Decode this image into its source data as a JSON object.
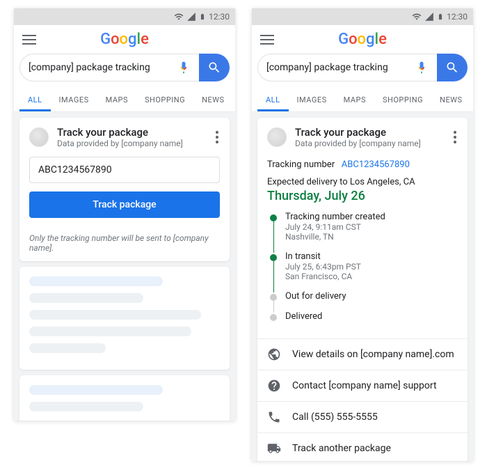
{
  "statusbar": {
    "time": "12:30"
  },
  "logo": {
    "text": "Google"
  },
  "search": {
    "query": "[company] package tracking",
    "placeholder": ""
  },
  "tabs": [
    "ALL",
    "IMAGES",
    "MAPS",
    "SHOPPING",
    "NEWS"
  ],
  "card": {
    "title": "Track your package",
    "subtitle": "Data provided by [company name]",
    "input_value": "ABC1234567890",
    "button": "Track package",
    "disclaimer": "Only the tracking number will be sent to [company name]."
  },
  "result": {
    "tracking_label": "Tracking number",
    "tracking_value": "ABC1234567890",
    "expected_line": "Expected delivery to Los Angeles, CA",
    "delivery_date": "Thursday, July 26",
    "steps": [
      {
        "label": "Tracking number created",
        "datetime": "July 24, 9:11am CST",
        "location": "Nashville, TN",
        "done": true
      },
      {
        "label": "In transit",
        "datetime": "July 25, 6:43pm PST",
        "location": "San Francisco, CA",
        "done": true
      },
      {
        "label": "Out for delivery",
        "datetime": "",
        "location": "",
        "done": false
      },
      {
        "label": "Delivered",
        "datetime": "",
        "location": "",
        "done": false
      }
    ],
    "links": [
      {
        "icon": "globe",
        "text": "View details on [company name].com"
      },
      {
        "icon": "help",
        "text": "Contact [company name] support"
      },
      {
        "icon": "phone",
        "text": "Call (555) 555-5555"
      },
      {
        "icon": "truck",
        "text": "Track another package"
      }
    ]
  }
}
